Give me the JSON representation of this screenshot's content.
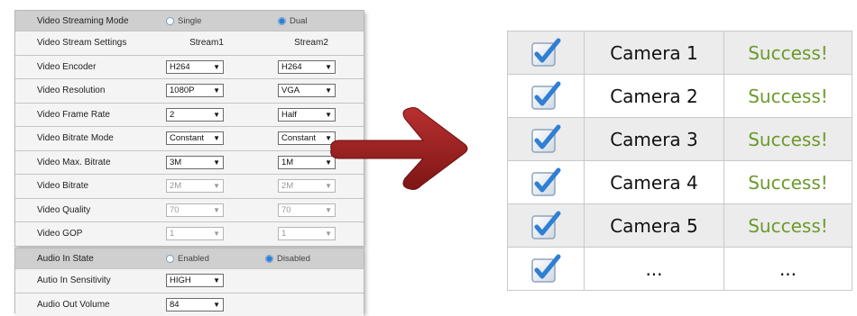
{
  "video_panel": {
    "rows": [
      {
        "label": "Video Streaming Mode",
        "kind": "radio",
        "opt1": "Single",
        "opt1_on": false,
        "opt2": "Dual",
        "opt2_on": true
      },
      {
        "label": "Video Stream Settings",
        "kind": "text",
        "v1": "Stream1",
        "v2": "Stream2"
      },
      {
        "label": "Video Encoder",
        "kind": "select",
        "v1": "H264",
        "v2": "H264",
        "disabled": false
      },
      {
        "label": "Video Resolution",
        "kind": "select",
        "v1": "1080P",
        "v2": "VGA",
        "disabled": false
      },
      {
        "label": "Video Frame Rate",
        "kind": "select",
        "v1": "2",
        "v2": "Half",
        "disabled": false
      },
      {
        "label": "Video Bitrate Mode",
        "kind": "select",
        "v1": "Constant",
        "v2": "Constant",
        "disabled": false
      },
      {
        "label": "Video Max. Bitrate",
        "kind": "select",
        "v1": "3M",
        "v2": "1M",
        "disabled": false
      },
      {
        "label": "Video Bitrate",
        "kind": "select",
        "v1": "2M",
        "v2": "2M",
        "disabled": true
      },
      {
        "label": "Video Quality",
        "kind": "select",
        "v1": "70",
        "v2": "70",
        "disabled": true
      },
      {
        "label": "Video GOP",
        "kind": "select",
        "v1": "1",
        "v2": "1",
        "disabled": true
      }
    ]
  },
  "audio_panel": {
    "rows": [
      {
        "label": "Audio In State",
        "kind": "radio",
        "opt1": "Enabled",
        "opt1_on": false,
        "opt2": "Disabled",
        "opt2_on": true
      },
      {
        "label": "Autio In Sensitivity",
        "kind": "select1",
        "v1": "HIGH"
      },
      {
        "label": "Audio Out Volume",
        "kind": "select1",
        "v1": "84"
      }
    ]
  },
  "cameras": [
    {
      "name": "Camera 1",
      "status": "Success!"
    },
    {
      "name": "Camera 2",
      "status": "Success!"
    },
    {
      "name": "Camera 3",
      "status": "Success!"
    },
    {
      "name": "Camera 4",
      "status": "Success!"
    },
    {
      "name": "Camera 5",
      "status": "Success!"
    },
    {
      "name": "...",
      "status": "..."
    }
  ],
  "colors": {
    "success": "#6b9a2a",
    "arrow": "#9b2222",
    "check": "#3a86d6"
  },
  "icons": {
    "check": "checkbox-checked-icon",
    "arrow": "right-arrow-icon"
  }
}
